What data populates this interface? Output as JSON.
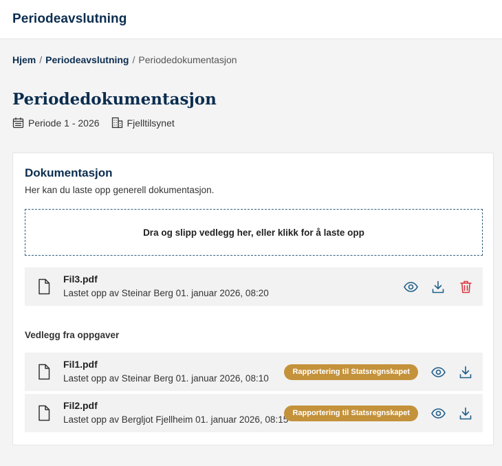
{
  "app": {
    "title": "Periodeavslutning"
  },
  "breadcrumb": {
    "items": [
      {
        "label": "Hjem"
      },
      {
        "label": "Periodeavslutning"
      },
      {
        "label": "Periodedokumentasjon"
      }
    ],
    "separator": "/"
  },
  "page": {
    "title": "Periodedokumentasjon",
    "period": "Periode 1 - 2026",
    "organization": "Fjelltilsynet"
  },
  "documentation": {
    "title": "Dokumentasjon",
    "description": "Her kan du laste opp generell dokumentasjon.",
    "dropzone_label": "Dra og slipp vedlegg her, eller klikk for å laste opp",
    "files": [
      {
        "name": "Fil3.pdf",
        "uploaded": "Lastet opp av Steinar Berg 01. januar 2026, 08:20"
      }
    ]
  },
  "attachments": {
    "title": "Vedlegg fra oppgaver",
    "files": [
      {
        "name": "Fil1.pdf",
        "uploaded": "Lastet opp av Steinar Berg 01. januar 2026, 08:10",
        "tag": "Rapportering til Statsregnskapet"
      },
      {
        "name": "Fil2.pdf",
        "uploaded": "Lastet opp av Bergljot Fjellheim 01. januar 2026, 08:15",
        "tag": "Rapportering til Statsregnskapet"
      }
    ]
  },
  "colors": {
    "primary": "#0b2d4f",
    "link_icon": "#1f5f8b",
    "delete": "#d9363e",
    "badge": "#c4923b",
    "background": "#f4f4f4"
  },
  "icons": {
    "period": "calendar-icon",
    "organization": "building-icon",
    "file": "document-icon",
    "view": "eye-icon",
    "download": "download-icon",
    "delete": "trash-icon"
  }
}
